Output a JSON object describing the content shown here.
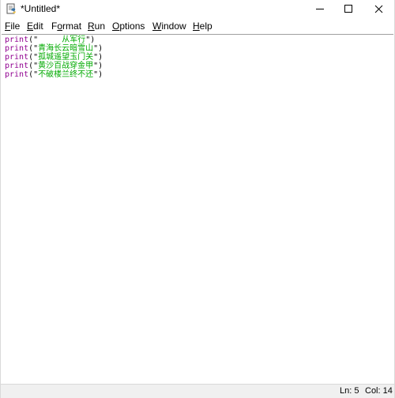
{
  "window": {
    "title": "*Untitled*"
  },
  "menu": {
    "items": [
      {
        "label": "File",
        "mnemonic": "F",
        "rest": "ile"
      },
      {
        "label": "Edit",
        "mnemonic": "E",
        "rest": "dit"
      },
      {
        "label": "Format",
        "pre": "F",
        "mnemonic": "o",
        "rest": "rmat"
      },
      {
        "label": "Run",
        "mnemonic": "R",
        "rest": "un"
      },
      {
        "label": "Options",
        "mnemonic": "O",
        "rest": "ptions"
      },
      {
        "label": "Window",
        "mnemonic": "W",
        "rest": "indow"
      },
      {
        "label": "Help",
        "mnemonic": "H",
        "rest": "elp"
      }
    ]
  },
  "editor": {
    "lines": [
      {
        "keyword": "print",
        "open": "(\"",
        "string": "     从军行",
        "close": "\")"
      },
      {
        "keyword": "print",
        "open": "(\"",
        "string": "青海长云暗雪山",
        "close": "\")"
      },
      {
        "keyword": "print",
        "open": "(\"",
        "string": "孤城遥望玉门关",
        "close": "\")"
      },
      {
        "keyword": "print",
        "open": "(\"",
        "string": "黄沙百战穿金甲",
        "close": "\")"
      },
      {
        "keyword": "print",
        "open": "(\"",
        "string": "不破楼兰终不还",
        "close": "\")"
      }
    ]
  },
  "status": {
    "line": "Ln: 5",
    "column": "Col: 14"
  },
  "colors": {
    "keyword": "#900090",
    "string": "#00aa00"
  },
  "icons": {
    "app": "python-idle-icon",
    "minimize": "minimize-icon",
    "maximize": "maximize-icon",
    "close": "close-icon"
  }
}
